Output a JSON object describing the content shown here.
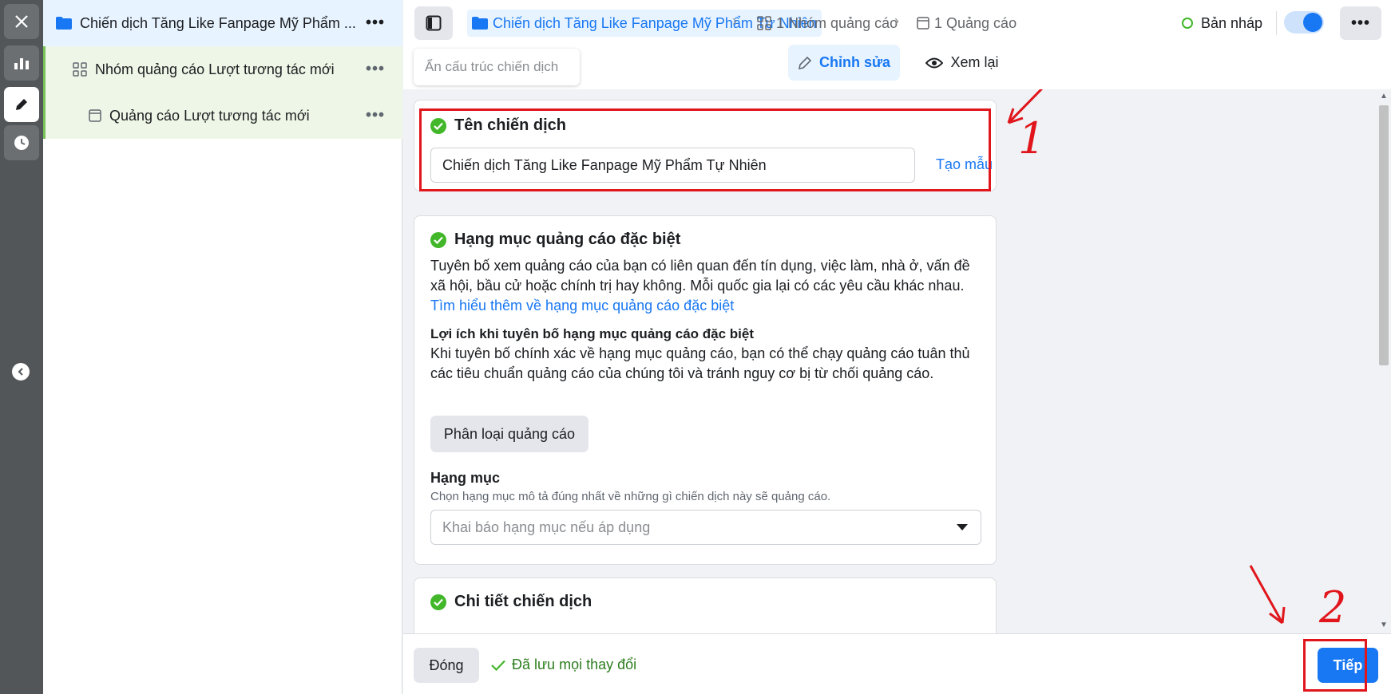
{
  "tree": {
    "campaign_label": "Chiến dịch Tăng Like Fanpage Mỹ Phẩm ...",
    "adset_label": "Nhóm quảng cáo Lượt tương tác mới",
    "ad_label": "Quảng cáo Lượt tương tác mới",
    "more": "•••"
  },
  "topbar": {
    "campaign_crumb": "Chiến dịch Tăng Like Fanpage Mỹ Phẩm Tự Nhiên",
    "adset_crumb": "1 Nhóm quảng cáo",
    "ad_crumb": "1 Quảng cáo",
    "separator": "›",
    "status": "Bản nháp",
    "more": "•••",
    "hide_structure": "Ẩn cấu trúc chiến dịch",
    "tab_edit": "Chỉnh sửa",
    "tab_review": "Xem lại"
  },
  "campaign_name": {
    "title": "Tên chiến dịch",
    "value": "Chiến dịch Tăng Like Fanpage Mỹ Phẩm Tự Nhiên",
    "template_link": "Tạo mẫu"
  },
  "special_category": {
    "title": "Hạng mục quảng cáo đặc biệt",
    "description": "Tuyên bố xem quảng cáo của bạn có liên quan đến tín dụng, việc làm, nhà ở, vấn đề xã hội, bầu cử hoặc chính trị hay không. Mỗi quốc gia lại có các yêu cầu khác nhau. ",
    "learn_more": "Tìm hiểu thêm về hạng mục quảng cáo đặc biệt",
    "benefit_heading": "Lợi ích khi tuyên bố hạng mục quảng cáo đặc biệt",
    "benefit_text": "Khi tuyên bố chính xác về hạng mục quảng cáo, bạn có thể chạy quảng cáo tuân thủ các tiêu chuẩn quảng cáo của chúng tôi và tránh nguy cơ bị từ chối quảng cáo.",
    "classify_button": "Phân loại quảng cáo",
    "category_label": "Hạng mục",
    "category_help": "Chọn hạng mục mô tả đúng nhất về những gì chiến dịch này sẽ quảng cáo.",
    "category_placeholder": "Khai báo hạng mục nếu áp dụng"
  },
  "campaign_details": {
    "title": "Chi tiết chiến dịch"
  },
  "footer": {
    "close": "Đóng",
    "saved": "Đã lưu mọi thay đổi",
    "next": "Tiếp"
  },
  "annotations": {
    "label_1": "1",
    "label_2": "2"
  },
  "colors": {
    "accent": "#1877f2",
    "success": "#42b72a",
    "annotation": "#e0161c"
  }
}
